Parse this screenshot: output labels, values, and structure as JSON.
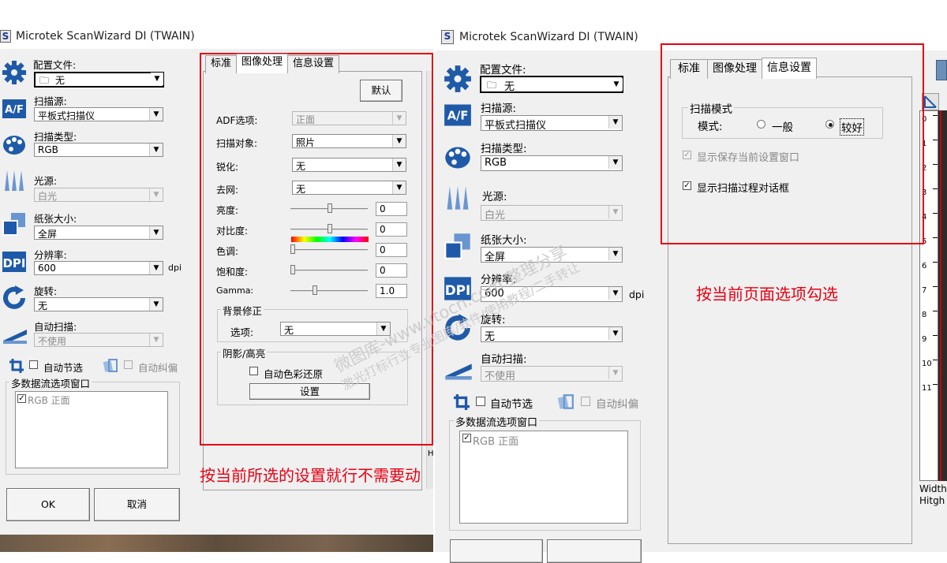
{
  "left_dialog": {
    "title": "Microtek ScanWizard DI (TWAIN)",
    "config_file": {
      "label": "配置文件:",
      "value": "无"
    },
    "scan_source": {
      "label": "扫描源:",
      "value": "平板式扫描仪"
    },
    "scan_type": {
      "label": "扫描类型:",
      "value": "RGB"
    },
    "light_source": {
      "label": "光源:",
      "value": "白光"
    },
    "paper_size": {
      "label": "纸张大小:",
      "value": "全屏"
    },
    "resolution": {
      "label": "分辨率:",
      "value": "600",
      "unit": "dpi"
    },
    "rotation": {
      "label": "旋转:",
      "value": "无"
    },
    "auto_scan": {
      "label": "自动扫描:",
      "value": "不使用"
    },
    "auto_crop": "自动节选",
    "auto_deskew": "自动纠偏",
    "multistream": {
      "label": "多数据流选项窗口",
      "item": "RGB 正面"
    },
    "ok_button": "OK",
    "cancel_button": "取消",
    "tabs": [
      "标准",
      "图像处理",
      "信息设置"
    ],
    "default_button": "默认",
    "adf": {
      "label": "ADF选项:",
      "value": "正面"
    },
    "scan_object": {
      "label": "扫描对象:",
      "value": "照片"
    },
    "sharpen": {
      "label": "锐化:",
      "value": "无"
    },
    "descreen": {
      "label": "去网:",
      "value": "无"
    },
    "sliders": [
      {
        "label": "亮度:",
        "value": "0"
      },
      {
        "label": "对比度:",
        "value": "0"
      },
      {
        "label": "色调:",
        "value": "0"
      },
      {
        "label": "饱和度:",
        "value": "0"
      },
      {
        "label": "Gamma:",
        "value": "1.0"
      }
    ],
    "bg_correction": {
      "title": "背景修正",
      "label": "选项:",
      "value": "无"
    },
    "shadow": {
      "title": "阴影/高亮",
      "checkbox": "自动色彩还原",
      "button": "设置"
    },
    "annotation": "按当前所选的设置就行不需要动",
    "edge_char": "H"
  },
  "right_dialog": {
    "title": "Microtek ScanWizard DI (TWAIN)",
    "config_file": {
      "label": "配置文件:",
      "value": "无"
    },
    "scan_source": {
      "label": "扫描源:",
      "value": "平板式扫描仪"
    },
    "scan_type": {
      "label": "扫描类型:",
      "value": "RGB"
    },
    "light_source": {
      "label": "光源:",
      "value": "白光"
    },
    "paper_size": {
      "label": "纸张大小:",
      "value": "全屏"
    },
    "resolution": {
      "label": "分辨率:",
      "value": "600",
      "unit": "dpi"
    },
    "rotation": {
      "label": "旋转:",
      "value": "无"
    },
    "auto_scan": {
      "label": "自动扫描:",
      "value": "不使用"
    },
    "auto_crop": "自动节选",
    "auto_deskew": "自动纠偏",
    "multistream": {
      "label": "多数据流选项窗口",
      "item": "RGB 正面"
    },
    "tabs": [
      "标准",
      "图像处理",
      "信息设置"
    ],
    "scan_mode": {
      "title": "扫描模式",
      "label": "模式:",
      "option_normal": "一般",
      "option_better": "较好"
    },
    "show_save_window": "显示保存当前设置窗口",
    "show_progress_dialog": "显示扫描过程对话框",
    "annotation": "按当前页面选项勾选",
    "ruler_numbers": [
      "0",
      "1",
      "2",
      "3",
      "4",
      "5",
      "6",
      "7",
      "8",
      "9",
      "10",
      "11"
    ],
    "width_label": "Width:",
    "height_label": "Hitgh :"
  },
  "watermark": {
    "line1": "微图库-www.vtocn.com 整理分享",
    "line2": "激光打标行业专业图库/软件/使用教程/二手转让"
  },
  "colors": {
    "annotation_red": "#e60012",
    "dialog_bg": "#f0f0f0",
    "icon_blue": "#1f5aa8"
  }
}
